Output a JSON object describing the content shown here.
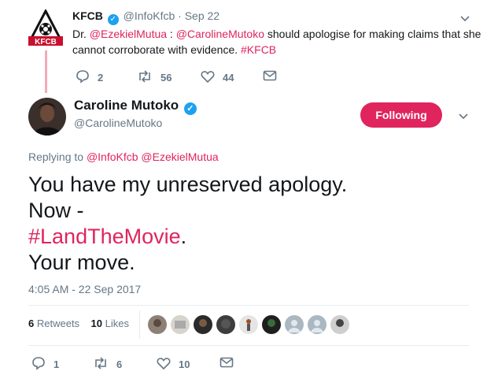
{
  "parent_tweet": {
    "author_name": "KFCB",
    "author_handle": "@InfoKfcb",
    "date": "· Sep 22",
    "text_parts": [
      {
        "text": "Dr. ",
        "color": "dark"
      },
      {
        "text": "@EzekielMutua",
        "color": "red"
      },
      {
        "text": " :  ",
        "color": "dark"
      },
      {
        "text": "@CarolineMutoko",
        "color": "red"
      },
      {
        "text": "  should apologise for making claims that she cannot corroborate with evidence. ",
        "color": "dark"
      },
      {
        "text": "#KFCB",
        "color": "red"
      }
    ],
    "replies": "2",
    "retweets": "56",
    "likes": "44",
    "avatar_text": "KFCB"
  },
  "main_tweet": {
    "author_name": "Caroline Mutoko",
    "author_handle": "@CarolineMutoko",
    "follow_label": "Following",
    "replying_to_label": "Replying to",
    "replying_to_1": "@InfoKfcb",
    "replying_to_2": "@EzekielMutua",
    "line1": "You have my unreserved apology.",
    "line2": "Now -",
    "line3_hashtag": "#LandTheMovie",
    "line3_rest": ".",
    "line4": "Your move.",
    "timestamp": "4:05 AM - 22 Sep 2017",
    "retweets_count": "6",
    "retweets_label": "Retweets",
    "likes_count": "10",
    "likes_label": "Likes",
    "reply_count": "1",
    "retweet_count_bar": "6",
    "like_count_bar": "10"
  },
  "colors": {
    "accent": "#e0245e",
    "muted": "#657786",
    "verified": "#1da1f2"
  }
}
